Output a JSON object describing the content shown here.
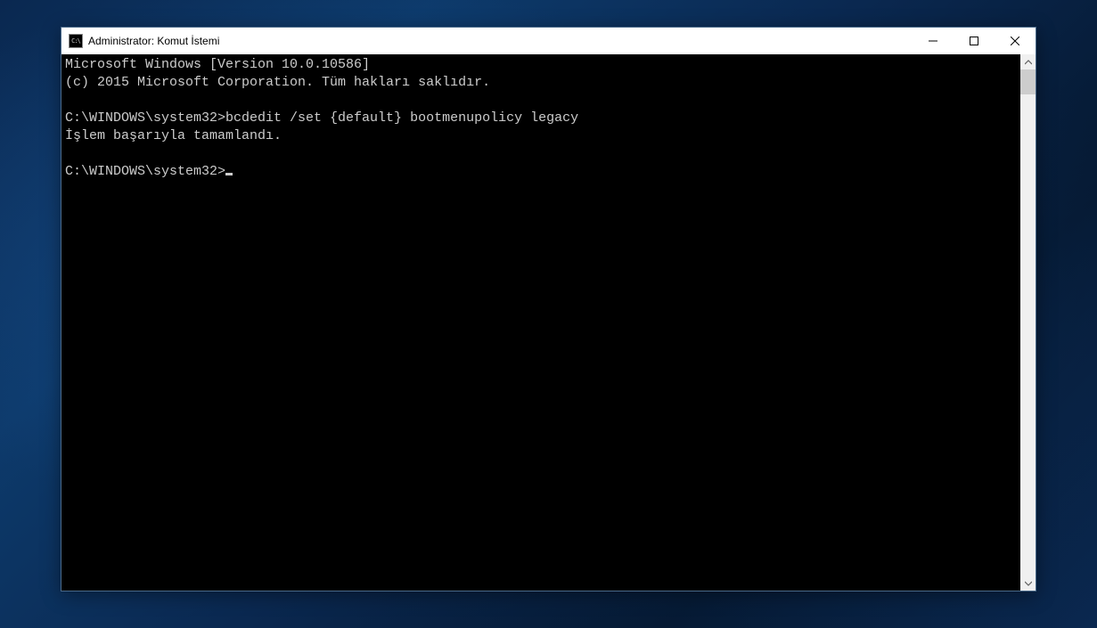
{
  "window": {
    "title": "Administrator: Komut İstemi",
    "icon_label": "C:\\"
  },
  "console": {
    "line1": "Microsoft Windows [Version 10.0.10586]",
    "line2": "(c) 2015 Microsoft Corporation. Tüm hakları saklıdır.",
    "blank1": "",
    "prompt1_path": "C:\\WINDOWS\\system32>",
    "prompt1_cmd": "bcdedit /set {default} bootmenupolicy legacy",
    "result": "İşlem başarıyla tamamlandı.",
    "blank2": "",
    "prompt2_path": "C:\\WINDOWS\\system32>"
  }
}
